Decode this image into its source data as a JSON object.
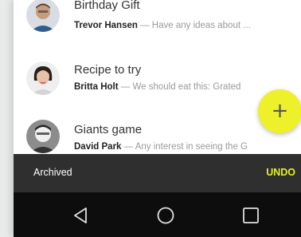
{
  "messages": [
    {
      "title": "Birthday Gift",
      "sender": "Trevor Hansen",
      "snippet": " — Have any ideas about ..."
    },
    {
      "title": "Recipe to try",
      "sender": "Britta Holt",
      "snippet": " — We should eat this: Grated"
    },
    {
      "title": "Giants game",
      "sender": "David Park",
      "snippet": " — Any interest in seeing the G"
    }
  ],
  "fab": {
    "label": "+",
    "color": "#eef02a"
  },
  "snackbar": {
    "message": "Archived",
    "action": "UNDO",
    "action_color": "#e8f020"
  },
  "navbar": {
    "back_icon": "back-triangle-icon",
    "home_icon": "home-circle-icon",
    "recents_icon": "recents-square-icon"
  }
}
